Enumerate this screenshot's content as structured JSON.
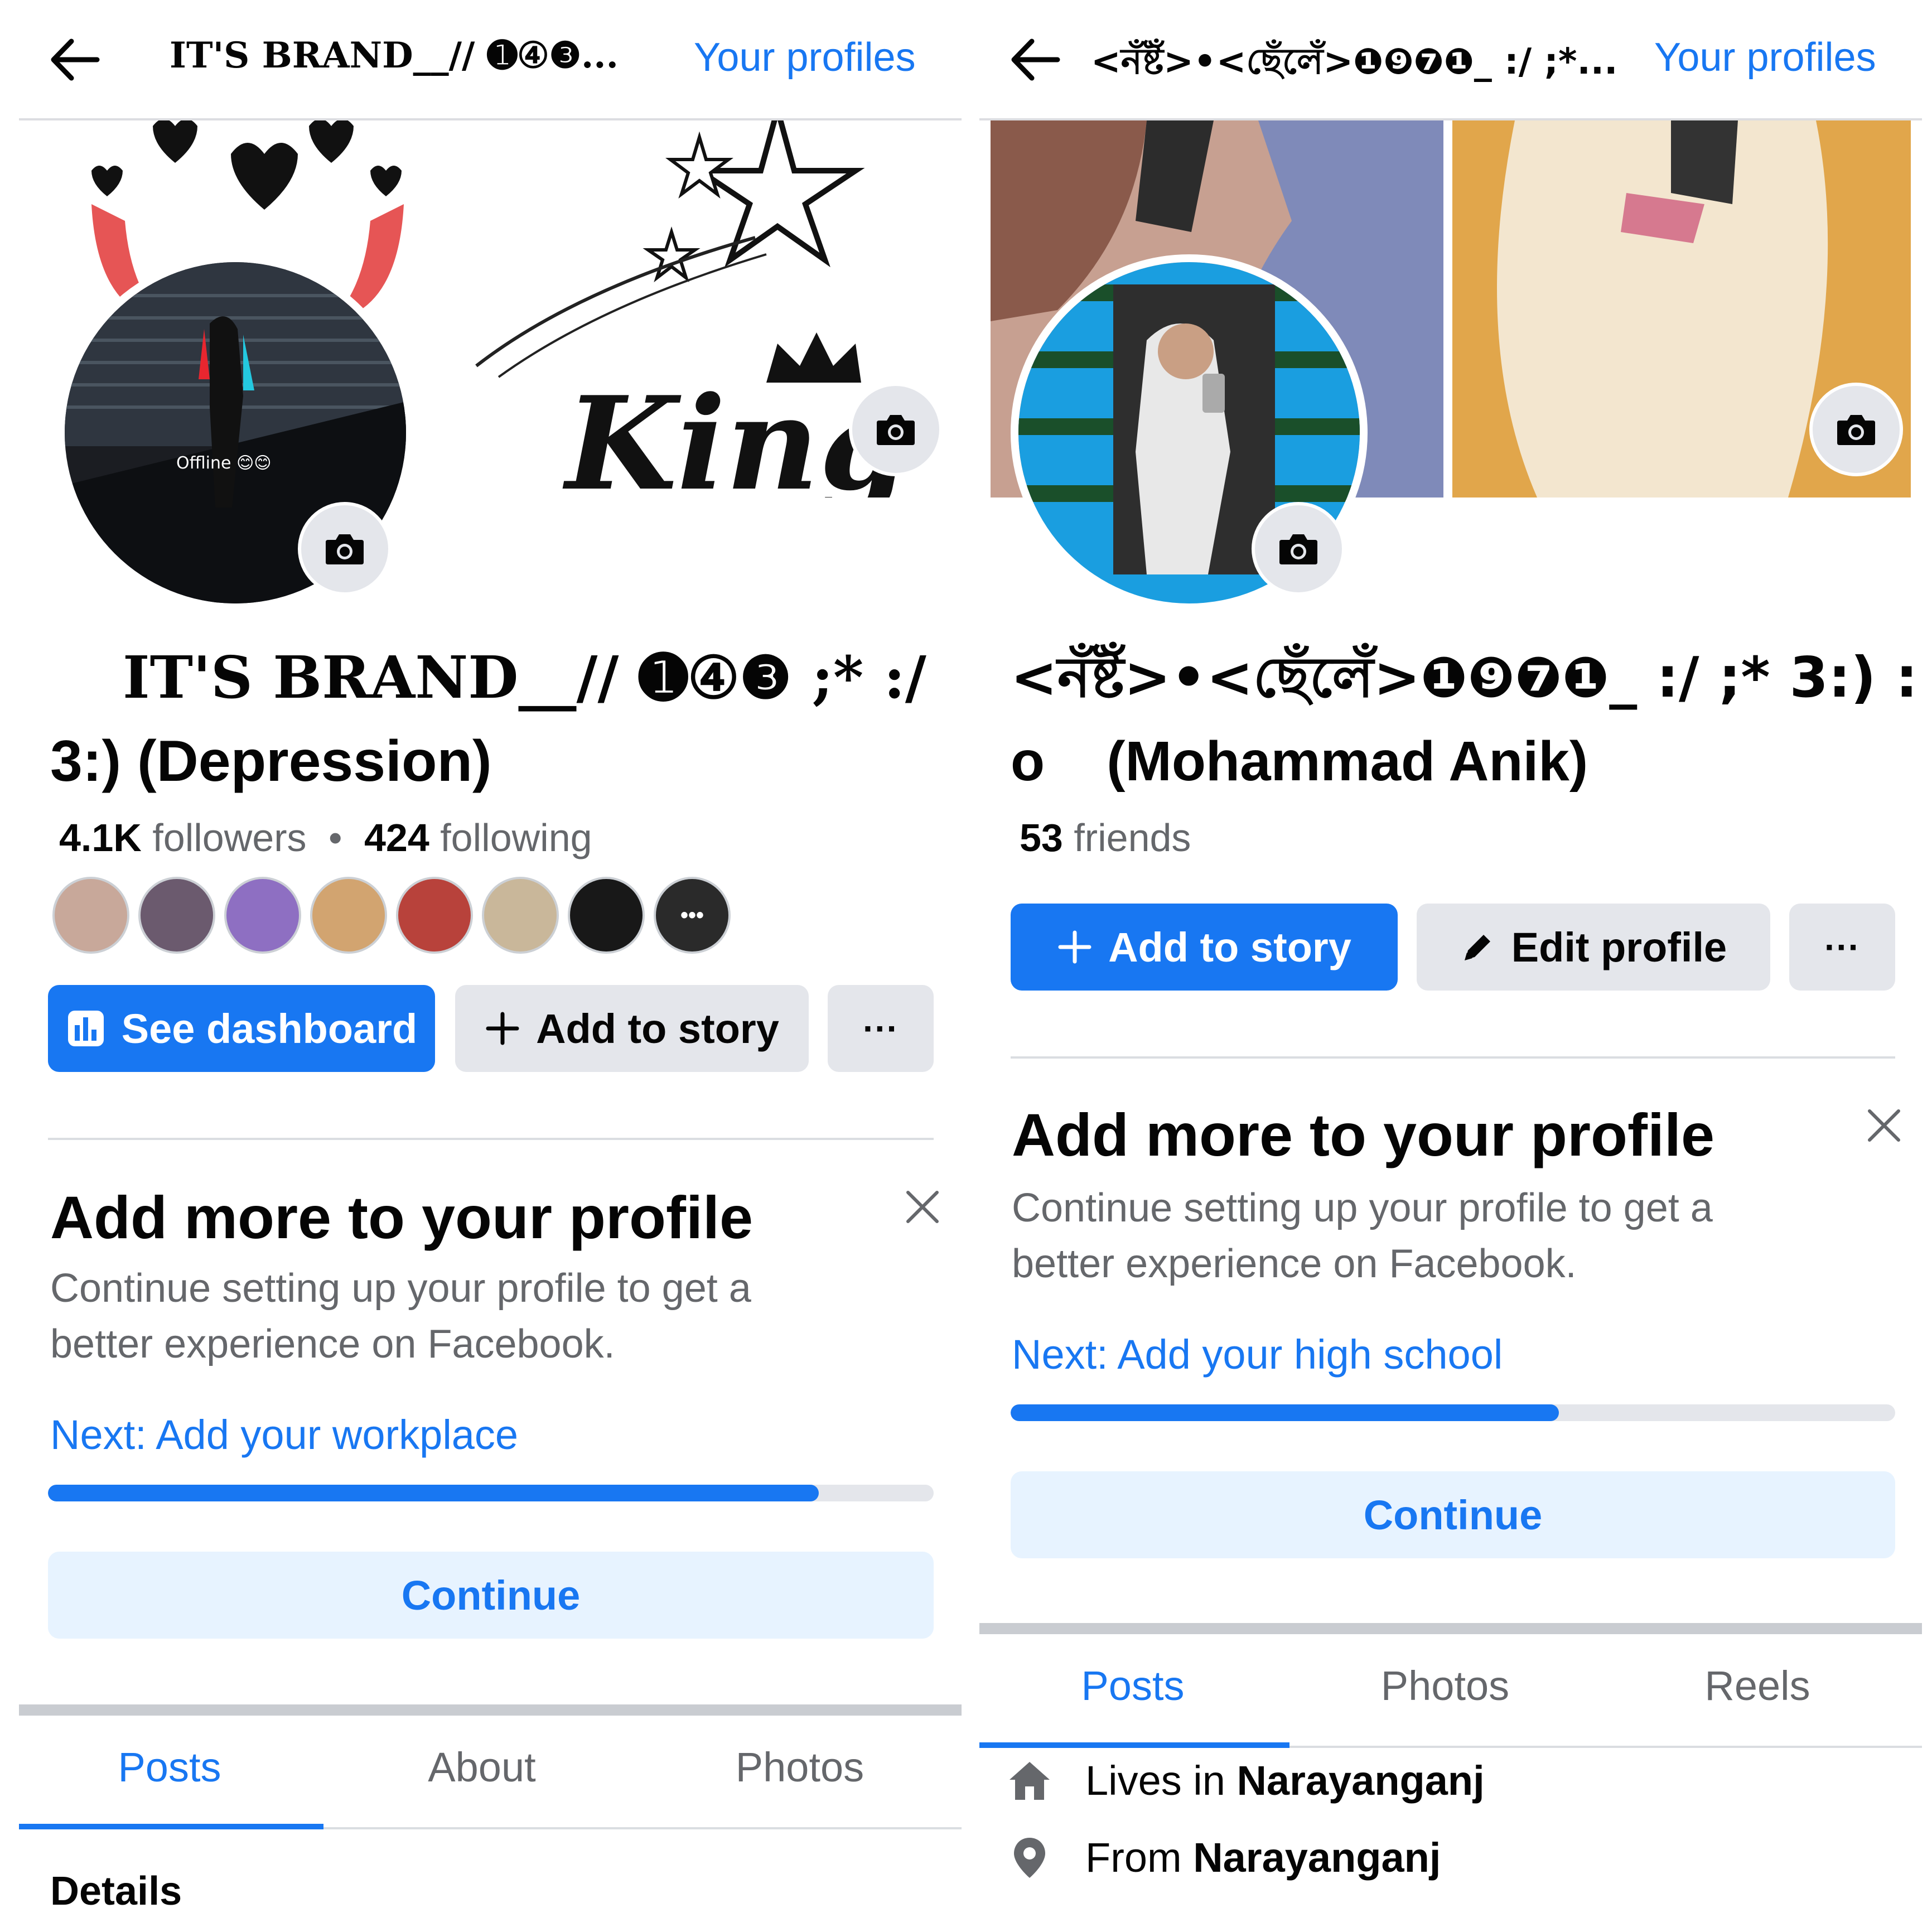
{
  "left": {
    "topbar_title": "IT'S BRAND__// ➊④❸...",
    "your_profiles": "Your profiles",
    "avatar_caption": "Offline 😊😊",
    "cover_text": "King",
    "name_line1": "IT'S BRAND__// ➊④❸ ;* :/",
    "name_line2": "3:) (Depression)",
    "followers_count": "4.1K",
    "followers_label": "followers",
    "following_count": "424",
    "following_label": "following",
    "stats_separator": "•",
    "more_friends_glyph": "•••",
    "dashboard_label": "See dashboard",
    "add_story_label": "Add to story",
    "more_label": "···",
    "card_title": "Add more to your profile",
    "card_desc": "Continue setting up your profile to get a better experience on Facebook.",
    "card_next": "Next: Add your workplace",
    "progress": 0.87,
    "continue_label": "Continue",
    "tabs": [
      "Posts",
      "About",
      "Photos"
    ],
    "details_label": "Details"
  },
  "right": {
    "topbar_title": "<নঁষ্টঁ>•<ছেঁলেঁ>❶❾❼❶_ :/ ;*...",
    "your_profiles": "Your profiles",
    "name_line1": "<নঁষ্টঁ>•<ছেঁলেঁ>❶❾❼❶_ :/ ;* 3:) :",
    "name_line2": "o    (Mohammad Anik)",
    "friends_count": "53",
    "friends_label": "friends",
    "add_story_label": "Add to story",
    "edit_profile_label": "Edit profile",
    "more_label": "···",
    "card_title": "Add more to your profile",
    "card_desc": "Continue setting up your profile to get a better experience on Facebook.",
    "card_next": "Next: Add your high school",
    "progress": 0.62,
    "continue_label": "Continue",
    "tabs": [
      "Posts",
      "Photos",
      "Reels"
    ],
    "lives_prefix": "Lives in ",
    "lives_city": "Narayanganj",
    "from_prefix": "From ",
    "from_city": "Narayanganj"
  },
  "colors": {
    "accent": "#1877f2",
    "secondary_bg": "#e4e6eb",
    "continue_bg": "#e7f3ff",
    "muted_text": "#65676b"
  },
  "icons": [
    "back-arrow-icon",
    "camera-icon",
    "dashboard-icon",
    "plus-icon",
    "pencil-icon",
    "close-icon",
    "home-icon",
    "location-pin-icon"
  ]
}
